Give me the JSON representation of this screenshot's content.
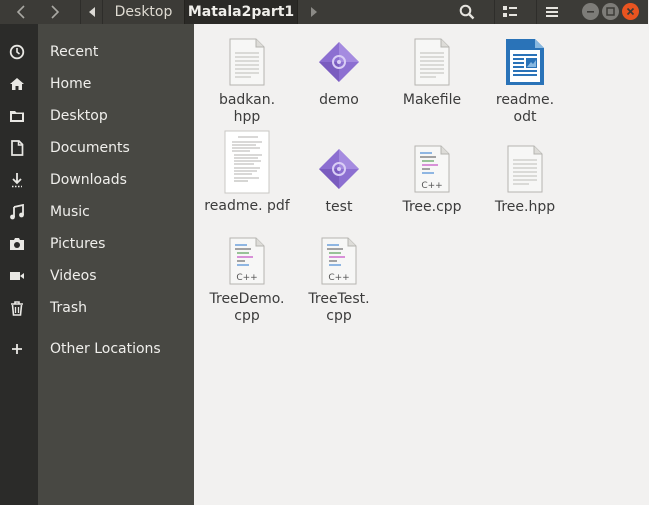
{
  "headerbar": {
    "breadcrumbs": [
      "Desktop",
      "Matala2part1"
    ],
    "icons": {
      "back": "chevron-left-icon",
      "forward": "chevron-right-icon",
      "path_left": "triangle-left-icon",
      "path_right": "triangle-right-icon",
      "search": "search-icon",
      "view": "list-view-icon",
      "menu": "hamburger-menu-icon",
      "minimize": "minimize-icon",
      "maximize": "maximize-icon",
      "close": "close-icon"
    }
  },
  "sidebar": {
    "items": [
      {
        "label": "Recent",
        "icon": "clock-icon"
      },
      {
        "label": "Home",
        "icon": "home-icon"
      },
      {
        "label": "Desktop",
        "icon": "folder-icon"
      },
      {
        "label": "Documents",
        "icon": "document-icon"
      },
      {
        "label": "Downloads",
        "icon": "download-icon"
      },
      {
        "label": "Music",
        "icon": "music-icon"
      },
      {
        "label": "Pictures",
        "icon": "camera-icon"
      },
      {
        "label": "Videos",
        "icon": "video-icon"
      },
      {
        "label": "Trash",
        "icon": "trash-icon"
      },
      {
        "label": "Other Locations",
        "icon": "plus-icon"
      }
    ]
  },
  "files": [
    {
      "name": "badkan.\nhpp",
      "type": "text"
    },
    {
      "name": "demo",
      "type": "executable"
    },
    {
      "name": "Makefile",
      "type": "text"
    },
    {
      "name": "readme.\nodt",
      "type": "odt"
    },
    {
      "name": "readme.\npdf",
      "type": "pdf"
    },
    {
      "name": "test",
      "type": "executable"
    },
    {
      "name": "Tree.cpp",
      "type": "cpp"
    },
    {
      "name": "Tree.hpp",
      "type": "text"
    },
    {
      "name": "TreeDemo.\ncpp",
      "type": "cpp"
    },
    {
      "name": "TreeTest.\ncpp",
      "type": "cpp"
    }
  ],
  "cpp_badge": "C++",
  "colors": {
    "headerbar": "#3c3b37",
    "sidebar": "#484843",
    "content": "#f2f1f0",
    "close_button": "#e95420",
    "executable": "#8c6fd1"
  }
}
